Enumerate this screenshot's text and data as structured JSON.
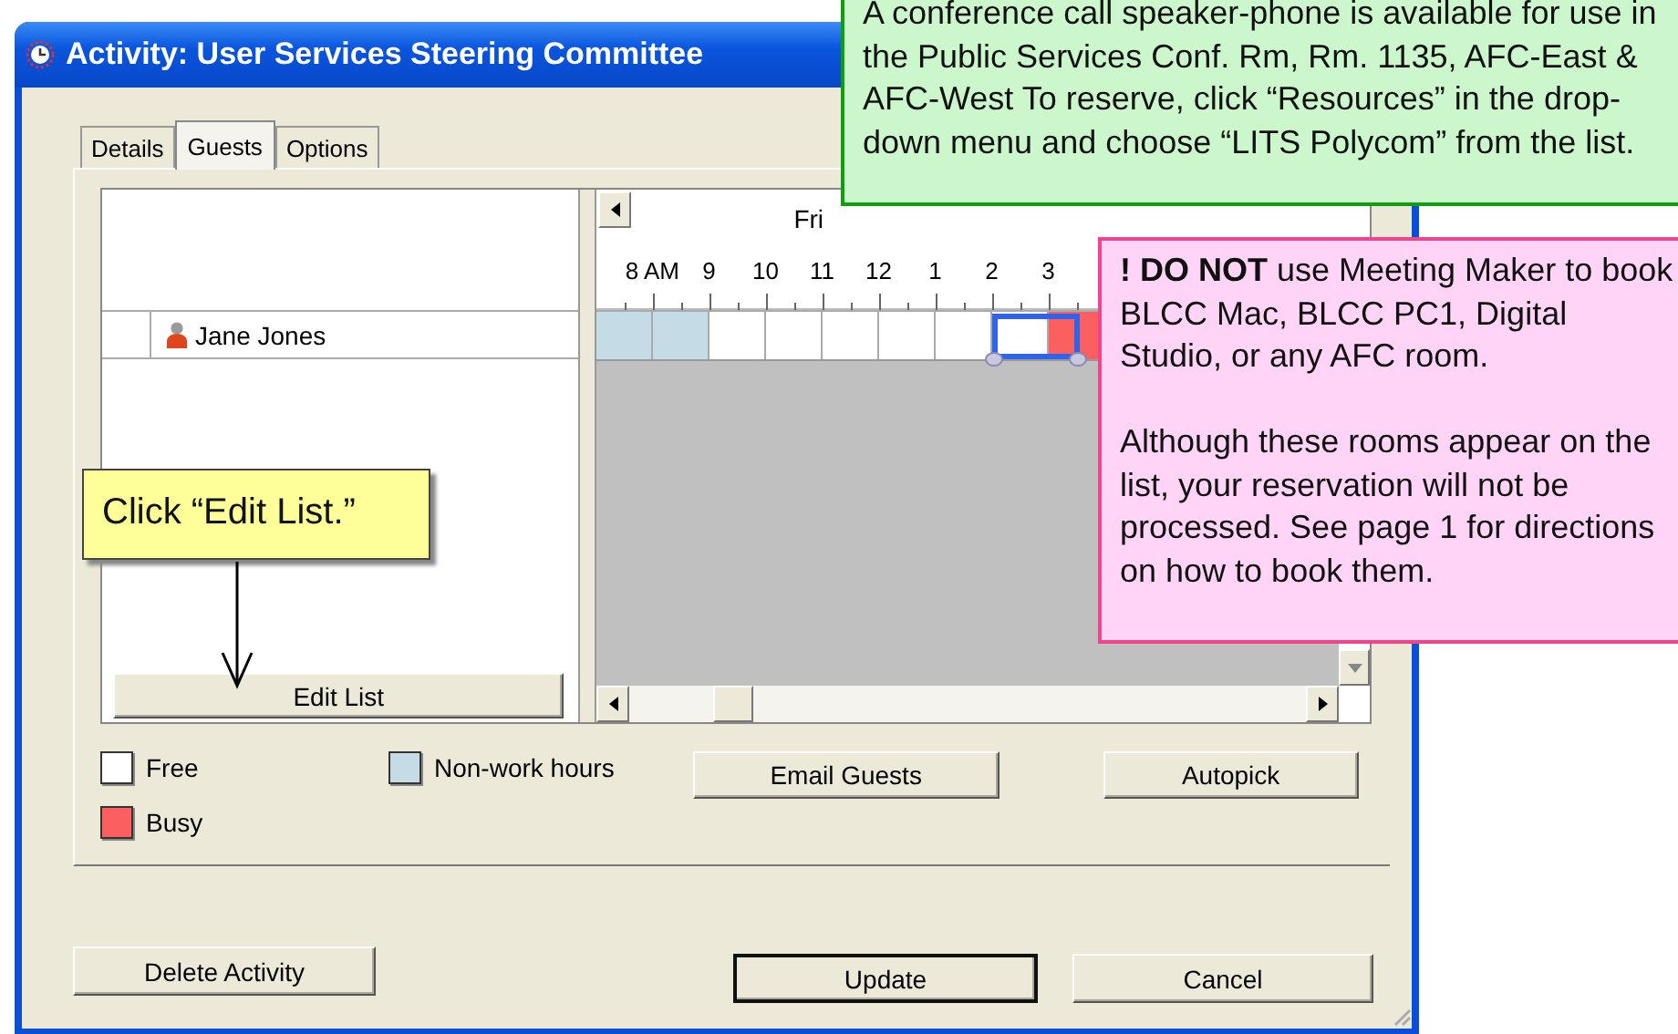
{
  "window": {
    "title": "Activity: User Services Steering Committee"
  },
  "tabs": [
    {
      "label": "Details",
      "selected": false
    },
    {
      "label": "Guests",
      "selected": true
    },
    {
      "label": "Options",
      "selected": false
    }
  ],
  "guests": [
    {
      "name": "Jane Jones"
    }
  ],
  "edit_button": "Edit List",
  "schedule": {
    "day": "Fri",
    "hours": [
      "8 AM",
      "9",
      "10",
      "11",
      "12",
      "1",
      "2",
      "3"
    ],
    "slots": [
      {
        "kind": "nonwork",
        "selected": false
      },
      {
        "kind": "nonwork",
        "selected": false
      },
      {
        "kind": "free",
        "selected": false
      },
      {
        "kind": "free",
        "selected": false
      },
      {
        "kind": "free",
        "selected": false
      },
      {
        "kind": "free",
        "selected": false
      },
      {
        "kind": "free",
        "selected": false
      },
      {
        "kind": "free",
        "selected": true
      },
      {
        "kind": "busy",
        "selected": false
      }
    ]
  },
  "legend": [
    {
      "label": "Free",
      "color": "#ffffff"
    },
    {
      "label": "Non-work hours",
      "color": "#c5dce6"
    },
    {
      "label": "Busy",
      "color": "#fb5f5f"
    }
  ],
  "actions": [
    "Email Guests",
    "Autopick"
  ],
  "footer_buttons": [
    {
      "label": "Delete Activity",
      "default": false
    },
    {
      "label": "Update",
      "default": true
    },
    {
      "label": "Cancel",
      "default": false
    }
  ],
  "callouts": [
    {
      "kind": "info",
      "paragraphs": [
        "A conference call speaker-phone is available for use in the Public Services Conf. Rm, Rm. 1135, AFC-East & AFC-West To reserve, click “Resources” in the drop-down menu and choose “LITS Polycom” from the list."
      ]
    },
    {
      "kind": "warning",
      "paragraphs": [
        "**! DO NOT** use Meeting Maker to book BLCC Mac, BLCC PC1, Digital Studio, or any AFC room.",
        "Although these rooms appear on the list, your reservation will not be processed. See page 1 for directions on how to book them."
      ]
    },
    {
      "kind": "step",
      "paragraphs": [
        "Click “Edit List.”"
      ]
    }
  ]
}
